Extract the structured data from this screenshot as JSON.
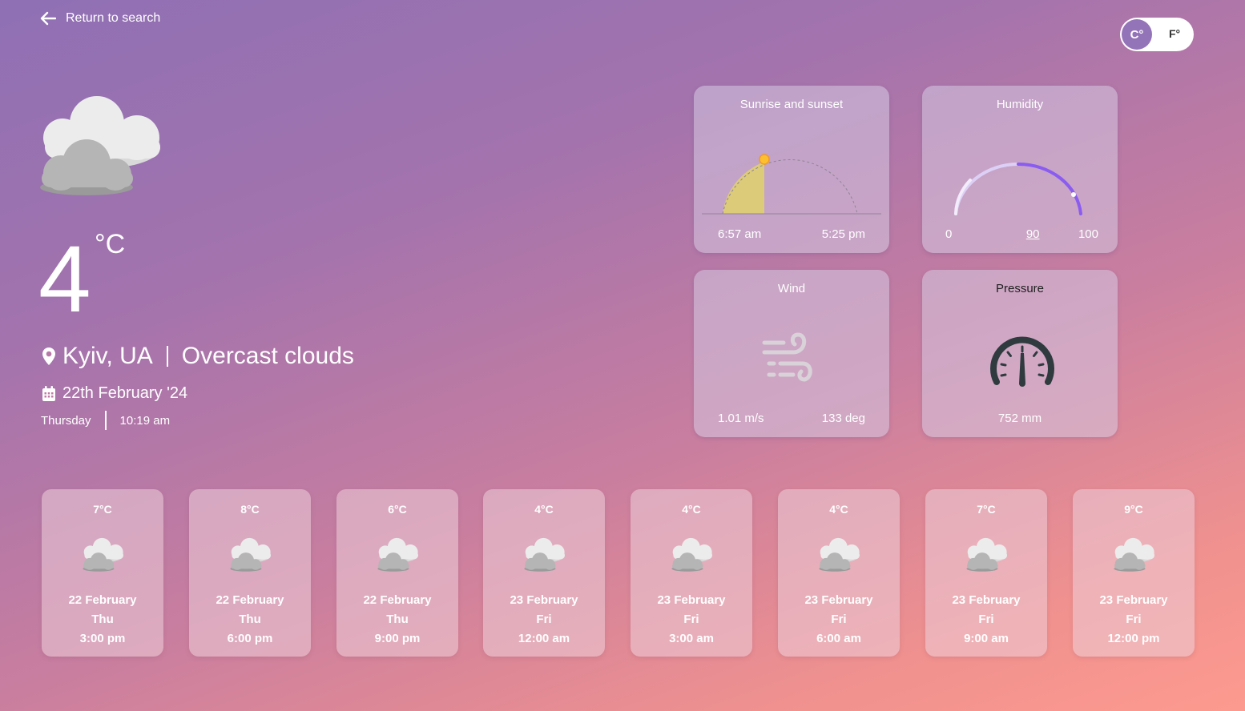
{
  "nav": {
    "back_label": "Return to search"
  },
  "units": {
    "celsius": "C°",
    "fahrenheit": "F°",
    "selected": "C°"
  },
  "current": {
    "icon": "overcast-clouds-icon",
    "temperature": "4",
    "unit": "°C",
    "location": "Kyiv, UA",
    "description": "Overcast clouds",
    "date": "22th February '24",
    "weekday": "Thursday",
    "time": "10:19 am"
  },
  "cards": {
    "sun": {
      "title": "Sunrise and sunset",
      "sunrise": "6:57 am",
      "sunset": "5:25 pm"
    },
    "humidity": {
      "title": "Humidity",
      "min": "0",
      "value": "90",
      "max": "100"
    },
    "wind": {
      "title": "Wind",
      "speed": "1.01 m/s",
      "direction": "133 deg"
    },
    "pressure": {
      "title": "Pressure",
      "value": "752 mm"
    }
  },
  "forecast": [
    {
      "temp": "7°C",
      "date": "22 February",
      "day": "Thu",
      "time": "3:00 pm"
    },
    {
      "temp": "8°C",
      "date": "22 February",
      "day": "Thu",
      "time": "6:00 pm"
    },
    {
      "temp": "6°C",
      "date": "22 February",
      "day": "Thu",
      "time": "9:00 pm"
    },
    {
      "temp": "4°C",
      "date": "23 February",
      "day": "Fri",
      "time": "12:00 am"
    },
    {
      "temp": "4°C",
      "date": "23 February",
      "day": "Fri",
      "time": "3:00 am"
    },
    {
      "temp": "4°C",
      "date": "23 February",
      "day": "Fri",
      "time": "6:00 am"
    },
    {
      "temp": "7°C",
      "date": "23 February",
      "day": "Fri",
      "time": "9:00 am"
    },
    {
      "temp": "9°C",
      "date": "23 February",
      "day": "Fri",
      "time": "12:00 pm"
    }
  ],
  "colors": {
    "accent": "#9474b8",
    "humidity_arc": "#8a5cf0",
    "sun_fill": "#dccb78",
    "sun_dot": "#fdbf2d"
  }
}
